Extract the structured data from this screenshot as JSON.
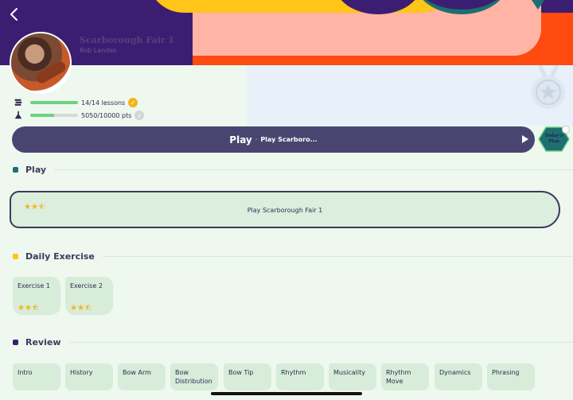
{
  "song": {
    "title": "Scarborough Fair 1",
    "artist": "Rob Landes"
  },
  "stats": {
    "lessons": {
      "text": "14/14 lessons",
      "progress": 1.0
    },
    "points": {
      "text": "5050/10000 pts",
      "progress": 0.505
    }
  },
  "play_bar": {
    "play": "Play",
    "separator": "·",
    "song": "Play Scarboro..."
  },
  "plan_badge": {
    "line1": "Today's",
    "line2": "Plan"
  },
  "sections": {
    "play": {
      "title": "Play",
      "color": "#1d6f70"
    },
    "daily": {
      "title": "Daily Exercise",
      "color": "#ffc519"
    },
    "review": {
      "title": "Review",
      "color": "#3b1e72"
    }
  },
  "play_card": {
    "title": "Play Scarborough Fair 1",
    "stars": 2.5
  },
  "exercises": [
    {
      "name": "Exercise 1",
      "stars": 2.5
    },
    {
      "name": "Exercise 2",
      "stars": 2.5
    }
  ],
  "review_items": [
    {
      "label": "Intro"
    },
    {
      "label": "History"
    },
    {
      "label": "Bow Arm"
    },
    {
      "label": "Bow Distribution"
    },
    {
      "label": "Bow Tip"
    },
    {
      "label": "Rhythm"
    },
    {
      "label": "Musicality"
    },
    {
      "label": "Rhythm Move"
    },
    {
      "label": "Dynamics"
    },
    {
      "label": "Phrasing"
    }
  ],
  "colors": {
    "accent": "#4a4570",
    "progress": "#6dd281",
    "star": "#f3b51a",
    "card": "#d7ecd9"
  },
  "icons": {
    "back": "chevron-left-icon",
    "lessons": "book-stack-icon",
    "points": "level-icon",
    "check": "check-circle-icon",
    "play": "play-triangle-icon",
    "medal": "medal-icon"
  }
}
